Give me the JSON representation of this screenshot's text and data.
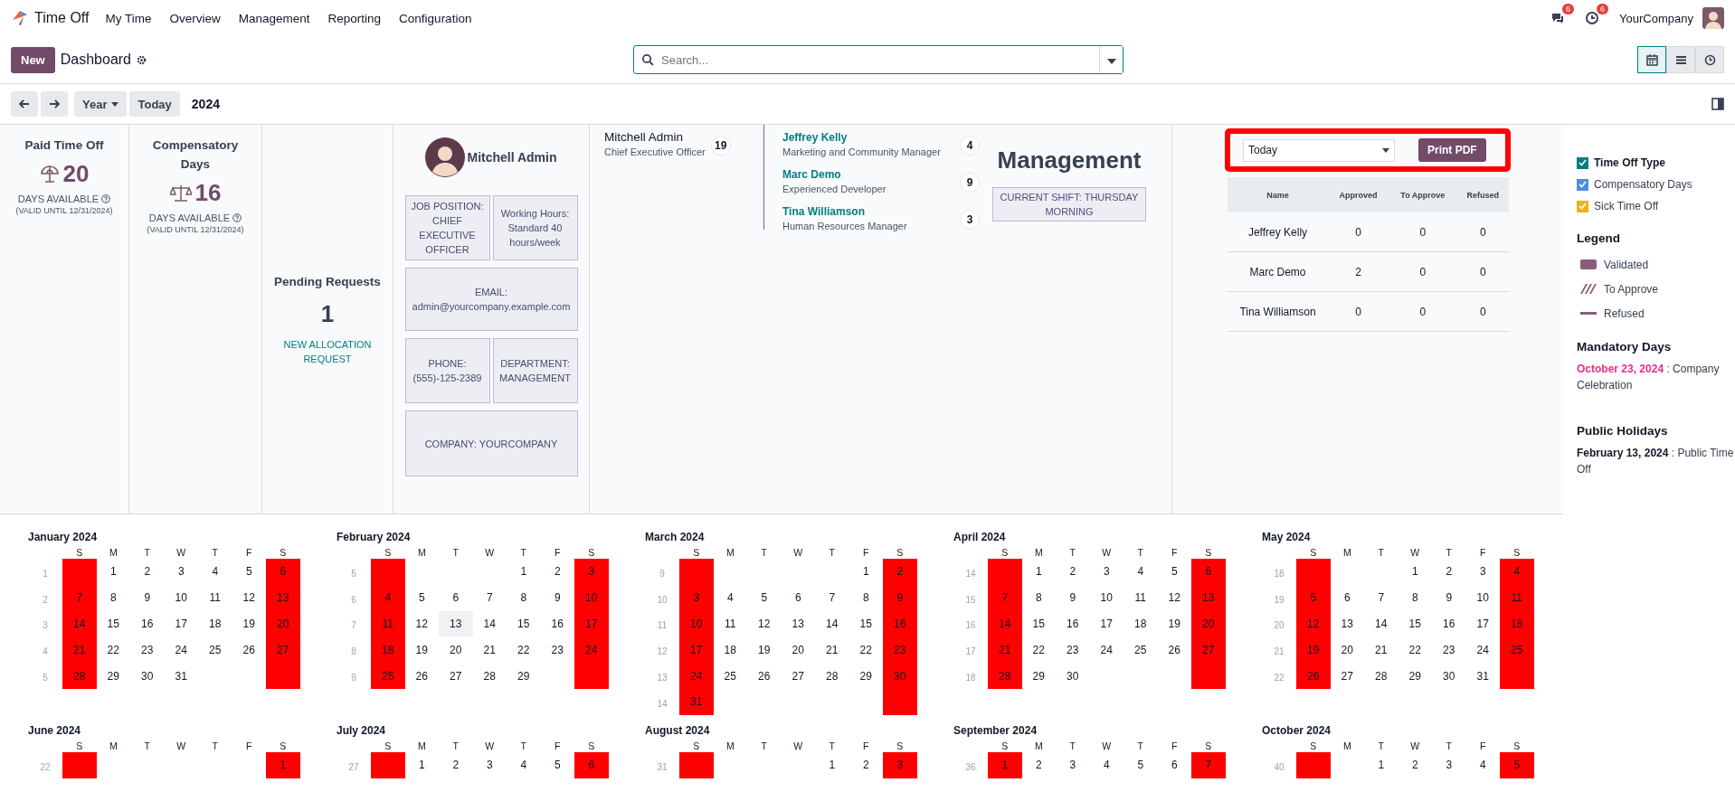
{
  "nav": {
    "app": "Time Off",
    "menu": [
      "My Time",
      "Overview",
      "Management",
      "Reporting",
      "Configuration"
    ],
    "messages_badge": "6",
    "activities_badge": "6",
    "company": "YourCompany"
  },
  "control": {
    "new_button": "New",
    "breadcrumb": "Dashboard",
    "search": {
      "placeholder": "Search..."
    },
    "views": [
      {
        "kind": "calendar",
        "selected": true
      },
      {
        "kind": "list",
        "selected": false
      },
      {
        "kind": "activity",
        "selected": false
      }
    ]
  },
  "date_nav": {
    "scale": "Year",
    "today": "Today",
    "period": "2024"
  },
  "balances": [
    {
      "title": "Paid Time Off",
      "amount": "20",
      "caption": "DAYS AVAILABLE",
      "validity": "(VALID UNTIL 12/31/2024)"
    },
    {
      "title": "Compensatory Days",
      "amount": "16",
      "caption": "DAYS AVAILABLE",
      "validity": "(VALID UNTIL 12/31/2024)"
    }
  ],
  "pending": {
    "title": "Pending Requests",
    "count": "1",
    "link": "NEW ALLOCATION REQUEST"
  },
  "profile": {
    "name": "Mitchell Admin",
    "job_position": "JOB POSITION: CHIEF EXECUTIVE OFFICER",
    "working_hours": "Working Hours: Standard 40 hours/week",
    "email": "EMAIL: admin@yourcompany.example.com",
    "phone": "PHONE: (555)-125-2389",
    "department": "DEPARTMENT: MANAGEMENT",
    "company": "COMPANY: YOURCOMPANY"
  },
  "org_chart": {
    "manager": {
      "name": "Mitchell Admin",
      "job": "Chief Executive Officer",
      "count": "19"
    },
    "reports": [
      {
        "name": "Jeffrey Kelly",
        "job": "Marketing and Community Manager",
        "count": "4"
      },
      {
        "name": "Marc Demo",
        "job": "Experienced Developer",
        "count": "9"
      },
      {
        "name": "Tina Williamson",
        "job": "Human Resources Manager",
        "count": "3"
      }
    ]
  },
  "department": {
    "title": "Management",
    "shift": "CURRENT SHIFT: THURSDAY MORNING"
  },
  "report": {
    "period": "Today",
    "print": "Print PDF",
    "highlighted": true,
    "columns": [
      "Name",
      "Approved",
      "To Approve",
      "Refused"
    ],
    "rows": [
      [
        "Jeffrey Kelly",
        "0",
        "0",
        "0"
      ],
      [
        "Marc Demo",
        "2",
        "0",
        "0"
      ],
      [
        "Tina Williamson",
        "0",
        "0",
        "0"
      ]
    ]
  },
  "sidebar": {
    "filter": {
      "label": "Time Off Type",
      "checked": true,
      "color": "#017e84"
    },
    "types": [
      {
        "label": "Compensatory Days",
        "checked": true,
        "color": "#4c8fe0"
      },
      {
        "label": "Sick Time Off",
        "checked": true,
        "color": "#eab21f"
      }
    ],
    "legend": {
      "title": "Legend",
      "items": [
        {
          "kind": "validated",
          "label": "Validated"
        },
        {
          "kind": "to_approve",
          "label": "To Approve"
        },
        {
          "kind": "refused",
          "label": "Refused"
        }
      ]
    },
    "mandatory_days": {
      "title": "Mandatory Days",
      "items": [
        "**October 23, 2024** : Company Celebration"
      ]
    },
    "public_holidays": {
      "title": "Public Holidays",
      "items": [
        "**February 13, 2024** : Public Time Off"
      ]
    }
  },
  "calendar": {
    "months": [
      {
        "title": "January 2024",
        "weekdays": [
          {
            "label": "S",
            "weekend": true
          },
          {
            "label": "M",
            "weekend": false
          },
          {
            "label": "T",
            "weekend": false
          },
          {
            "label": "W",
            "weekend": false
          },
          {
            "label": "T",
            "weekend": false
          },
          {
            "label": "F",
            "weekend": false
          },
          {
            "label": "S",
            "weekend": true
          }
        ],
        "weeks": [
          {
            "week": "1",
            "fill_from_end": true,
            "days": [
              "1",
              "2",
              "3",
              "4",
              "5",
              "6"
            ]
          },
          {
            "week": "2",
            "days": [
              "7",
              "8",
              "9",
              "10",
              "11",
              "12",
              "13"
            ]
          },
          {
            "week": "3",
            "days": [
              "14",
              "15",
              "16",
              "17",
              "18",
              "19",
              "20"
            ]
          },
          {
            "week": "4",
            "days": [
              "21",
              "22",
              "23",
              "24",
              "25",
              "26",
              "27"
            ]
          },
          {
            "week": "5",
            "days": [
              "28",
              "29",
              "30",
              "31"
            ]
          }
        ]
      },
      {
        "title": "February 2024",
        "weekdays": [
          {
            "label": "S",
            "weekend": true
          },
          {
            "label": "M",
            "weekend": false
          },
          {
            "label": "T",
            "weekend": false
          },
          {
            "label": "W",
            "weekend": false
          },
          {
            "label": "T",
            "weekend": false
          },
          {
            "label": "F",
            "weekend": false
          },
          {
            "label": "S",
            "weekend": true
          }
        ],
        "weeks": [
          {
            "week": "5",
            "fill_from_end": true,
            "days": [
              "1",
              "2",
              "3"
            ]
          },
          {
            "week": "6",
            "days": [
              "4",
              "5",
              "6",
              "7",
              "8",
              "9",
              "10"
            ]
          },
          {
            "week": "7",
            "days": [
              "11",
              "12",
              {
                "day": "13",
                "highlighted": true
              },
              "14",
              "15",
              "16",
              "17"
            ]
          },
          {
            "week": "8",
            "days": [
              "18",
              "19",
              "20",
              "21",
              "22",
              "23",
              "24"
            ]
          },
          {
            "week": "9",
            "days": [
              "25",
              "26",
              "27",
              "28",
              "29"
            ]
          }
        ]
      },
      {
        "title": "March 2024",
        "weekdays": [
          {
            "label": "S",
            "weekend": true
          },
          {
            "label": "M",
            "weekend": false
          },
          {
            "label": "T",
            "weekend": false
          },
          {
            "label": "W",
            "weekend": false
          },
          {
            "label": "T",
            "weekend": false
          },
          {
            "label": "F",
            "weekend": false
          },
          {
            "label": "S",
            "weekend": true
          }
        ],
        "weeks": [
          {
            "week": "9",
            "fill_from_end": true,
            "days": [
              "1",
              "2"
            ]
          },
          {
            "week": "10",
            "days": [
              "3",
              "4",
              "5",
              "6",
              "7",
              "8",
              "9"
            ]
          },
          {
            "week": "11",
            "days": [
              "10",
              "11",
              "12",
              "13",
              "14",
              "15",
              "16"
            ]
          },
          {
            "week": "12",
            "days": [
              "17",
              "18",
              "19",
              "20",
              "21",
              "22",
              "23"
            ]
          },
          {
            "week": "13",
            "days": [
              "24",
              "25",
              "26",
              "27",
              "28",
              "29",
              "30"
            ]
          },
          {
            "week": "14",
            "days": [
              "31"
            ]
          }
        ]
      },
      {
        "title": "April 2024",
        "weekdays": [
          {
            "label": "S",
            "weekend": true
          },
          {
            "label": "M",
            "weekend": false
          },
          {
            "label": "T",
            "weekend": false
          },
          {
            "label": "W",
            "weekend": false
          },
          {
            "label": "T",
            "weekend": false
          },
          {
            "label": "F",
            "weekend": false
          },
          {
            "label": "S",
            "weekend": true
          }
        ],
        "weeks": [
          {
            "week": "14",
            "fill_from_end": true,
            "days": [
              "1",
              "2",
              "3",
              "4",
              "5",
              "6"
            ]
          },
          {
            "week": "15",
            "days": [
              "7",
              "8",
              "9",
              "10",
              "11",
              "12",
              "13"
            ]
          },
          {
            "week": "16",
            "days": [
              "14",
              "15",
              "16",
              "17",
              "18",
              "19",
              "20"
            ]
          },
          {
            "week": "17",
            "days": [
              "21",
              "22",
              "23",
              "24",
              "25",
              "26",
              "27"
            ]
          },
          {
            "week": "18",
            "days": [
              "28",
              "29",
              "30"
            ]
          }
        ]
      },
      {
        "title": "May 2024",
        "weekdays": [
          {
            "label": "S",
            "weekend": true
          },
          {
            "label": "M",
            "weekend": false
          },
          {
            "label": "T",
            "weekend": false
          },
          {
            "label": "W",
            "weekend": false
          },
          {
            "label": "T",
            "weekend": false
          },
          {
            "label": "F",
            "weekend": false
          },
          {
            "label": "S",
            "weekend": true
          }
        ],
        "weeks": [
          {
            "week": "18",
            "fill_from_end": true,
            "days": [
              "1",
              "2",
              "3",
              "4"
            ]
          },
          {
            "week": "19",
            "days": [
              "5",
              "6",
              "7",
              "8",
              "9",
              "10",
              "11"
            ]
          },
          {
            "week": "20",
            "days": [
              "12",
              "13",
              "14",
              "15",
              "16",
              "17",
              "18"
            ]
          },
          {
            "week": "21",
            "days": [
              "19",
              "20",
              "21",
              "22",
              "23",
              "24",
              "25"
            ]
          },
          {
            "week": "22",
            "days": [
              "26",
              "27",
              "28",
              "29",
              "30",
              "31"
            ]
          }
        ]
      },
      {
        "title": "June 2024",
        "weekdays": [
          {
            "label": "S",
            "weekend": true
          },
          {
            "label": "M",
            "weekend": false
          },
          {
            "label": "T",
            "weekend": false
          },
          {
            "label": "W",
            "weekend": false
          },
          {
            "label": "T",
            "weekend": false
          },
          {
            "label": "F",
            "weekend": false
          },
          {
            "label": "S",
            "weekend": true
          }
        ],
        "weeks": [
          {
            "week": "22",
            "fill_from_end": true,
            "days": [
              "1"
            ]
          }
        ]
      },
      {
        "title": "July 2024",
        "weekdays": [
          {
            "label": "S",
            "weekend": true
          },
          {
            "label": "M",
            "weekend": false
          },
          {
            "label": "T",
            "weekend": false
          },
          {
            "label": "W",
            "weekend": false
          },
          {
            "label": "T",
            "weekend": false
          },
          {
            "label": "F",
            "weekend": false
          },
          {
            "label": "S",
            "weekend": true
          }
        ],
        "weeks": [
          {
            "week": "27",
            "fill_from_end": true,
            "days": [
              "1",
              "2",
              "3",
              "4",
              "5",
              "6"
            ]
          }
        ]
      },
      {
        "title": "August 2024",
        "weekdays": [
          {
            "label": "S",
            "weekend": true
          },
          {
            "label": "M",
            "weekend": false
          },
          {
            "label": "T",
            "weekend": false
          },
          {
            "label": "W",
            "weekend": false
          },
          {
            "label": "T",
            "weekend": false
          },
          {
            "label": "F",
            "weekend": false
          },
          {
            "label": "S",
            "weekend": true
          }
        ],
        "weeks": [
          {
            "week": "31",
            "fill_from_end": true,
            "days": [
              "1",
              "2",
              "3"
            ]
          }
        ]
      },
      {
        "title": "September 2024",
        "weekdays": [
          {
            "label": "S",
            "weekend": true
          },
          {
            "label": "M",
            "weekend": false
          },
          {
            "label": "T",
            "weekend": false
          },
          {
            "label": "W",
            "weekend": false
          },
          {
            "label": "T",
            "weekend": false
          },
          {
            "label": "F",
            "weekend": false
          },
          {
            "label": "S",
            "weekend": true
          }
        ],
        "weeks": [
          {
            "week": "36",
            "days": [
              "1",
              "2",
              "3",
              "4",
              "5",
              "6",
              "7"
            ]
          }
        ]
      },
      {
        "title": "October 2024",
        "weekdays": [
          {
            "label": "S",
            "weekend": true
          },
          {
            "label": "M",
            "weekend": false
          },
          {
            "label": "T",
            "weekend": false
          },
          {
            "label": "W",
            "weekend": false
          },
          {
            "label": "T",
            "weekend": false
          },
          {
            "label": "F",
            "weekend": false
          },
          {
            "label": "S",
            "weekend": true
          }
        ],
        "weeks": [
          {
            "week": "40",
            "fill_from_end": true,
            "days": [
              "1",
              "2",
              "3",
              "4",
              "5"
            ]
          }
        ]
      }
    ]
  }
}
